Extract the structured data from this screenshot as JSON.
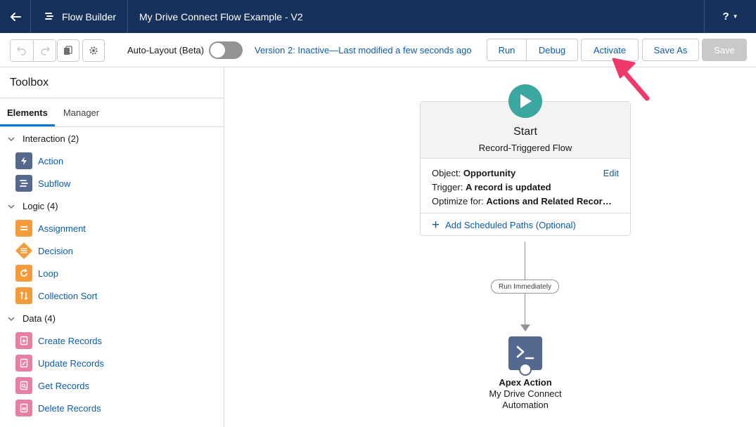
{
  "topbar": {
    "app_name": "Flow Builder",
    "flow_title": "My Drive Connect Flow Example - V2",
    "help_label": "?"
  },
  "toolbar": {
    "autolayout_label": "Auto-Layout (Beta)",
    "version_status": "Version 2: Inactive—Last modified a few seconds ago",
    "run_label": "Run",
    "debug_label": "Debug",
    "activate_label": "Activate",
    "saveas_label": "Save As",
    "save_label": "Save"
  },
  "sidebar": {
    "title": "Toolbox",
    "tabs": [
      {
        "label": "Elements"
      },
      {
        "label": "Manager"
      }
    ],
    "sections": [
      {
        "label": "Interaction (2)",
        "items": [
          {
            "label": "Action"
          },
          {
            "label": "Subflow"
          }
        ]
      },
      {
        "label": "Logic (4)",
        "items": [
          {
            "label": "Assignment"
          },
          {
            "label": "Decision"
          },
          {
            "label": "Loop"
          },
          {
            "label": "Collection Sort"
          }
        ]
      },
      {
        "label": "Data (4)",
        "items": [
          {
            "label": "Create Records"
          },
          {
            "label": "Update Records"
          },
          {
            "label": "Get Records"
          },
          {
            "label": "Delete Records"
          }
        ]
      }
    ]
  },
  "canvas": {
    "start": {
      "title": "Start",
      "subtitle": "Record-Triggered Flow",
      "object_label": "Object:",
      "object_value": "Opportunity",
      "edit_label": "Edit",
      "trigger_label": "Trigger:",
      "trigger_value": "A record is updated",
      "optimize_label": "Optimize for:",
      "optimize_value": "Actions and Related Recor…",
      "scheduled_paths_label": "Add Scheduled Paths (Optional)"
    },
    "path_label": "Run Immediately",
    "apex": {
      "title": "Apex Action",
      "subtitle_line1": "My Drive Connect",
      "subtitle_line2": "Automation"
    }
  },
  "colors": {
    "topbar": "#16325c",
    "link": "#0b5cab",
    "start_icon": "#3ba7a0",
    "apex_icon": "#54698d",
    "annotation_arrow": "#f0386b"
  }
}
